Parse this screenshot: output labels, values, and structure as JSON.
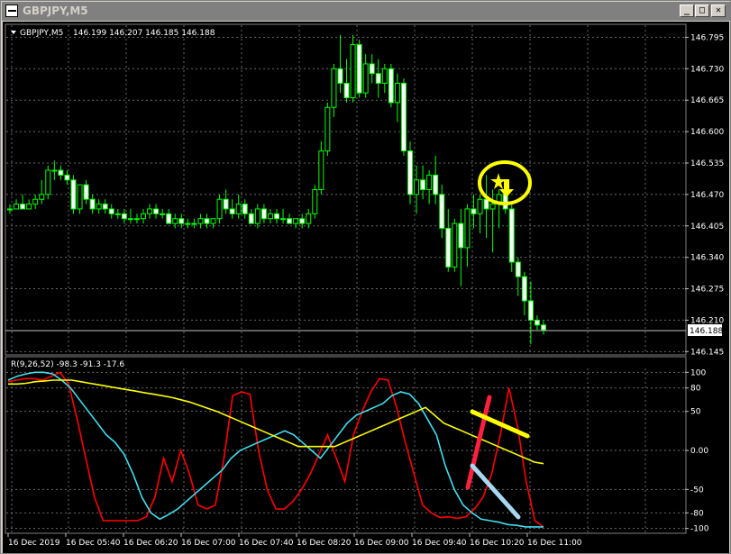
{
  "window": {
    "title": "GBPJPY,M5"
  },
  "colors": {
    "bg": "#000000",
    "grid": "#c0c0c0",
    "bull": "#00ff00",
    "bear": "#ffffff",
    "red": "#ff0000",
    "cyan": "#40e0f0",
    "yellow": "#ffff00",
    "text": "#ffffff"
  },
  "icons": {
    "window": "app-chart-icon",
    "minimize": "minimize-icon",
    "maximize": "maximize-icon",
    "close": "close-icon",
    "collapse": "triangle-down-icon",
    "signal_star": "star-icon",
    "signal_arrow": "down-arrow-icon",
    "highlight": "yellow-circle-annotation"
  },
  "chart_data": [
    {
      "type": "candlestick",
      "title": "GBPJPY,M5",
      "ohlc_header": "146.199 146.207 146.185 146.188",
      "current_price": "146.188",
      "y_ticks": [
        "146.795",
        "146.730",
        "146.665",
        "146.600",
        "146.535",
        "146.470",
        "146.405",
        "146.340",
        "146.275",
        "146.210",
        "146.145"
      ],
      "ylim": [
        146.14,
        146.82
      ],
      "x_labels": [
        "16 Dec 2019",
        "16 Dec 05:40",
        "16 Dec 06:20",
        "16 Dec 07:00",
        "16 Dec 07:40",
        "16 Dec 08:20",
        "16 Dec 09:00",
        "16 Dec 09:40",
        "16 Dec 10:20",
        "16 Dec 11:00"
      ],
      "grid": true,
      "candles": [
        [
          146.44,
          146.45,
          146.43,
          146.44
        ],
        [
          146.44,
          146.46,
          146.44,
          146.45
        ],
        [
          146.45,
          146.47,
          146.44,
          146.44
        ],
        [
          146.44,
          146.46,
          146.44,
          146.45
        ],
        [
          146.45,
          146.47,
          146.44,
          146.46
        ],
        [
          146.46,
          146.5,
          146.45,
          146.47
        ],
        [
          146.47,
          146.53,
          146.46,
          146.52
        ],
        [
          146.52,
          146.54,
          146.5,
          146.52
        ],
        [
          146.52,
          146.53,
          146.5,
          146.51
        ],
        [
          146.51,
          146.52,
          146.49,
          146.5
        ],
        [
          146.5,
          146.51,
          146.43,
          146.44
        ],
        [
          146.44,
          146.49,
          146.43,
          146.49
        ],
        [
          146.49,
          146.5,
          146.45,
          146.46
        ],
        [
          146.46,
          146.47,
          146.43,
          146.44
        ],
        [
          146.44,
          146.46,
          146.43,
          146.45
        ],
        [
          146.45,
          146.46,
          146.43,
          146.44
        ],
        [
          146.44,
          146.45,
          146.42,
          146.43
        ],
        [
          146.43,
          146.44,
          146.42,
          146.43
        ],
        [
          146.43,
          146.44,
          146.41,
          146.42
        ],
        [
          146.42,
          146.44,
          146.41,
          146.42
        ],
        [
          146.42,
          146.43,
          146.41,
          146.42
        ],
        [
          146.42,
          146.44,
          146.41,
          146.43
        ],
        [
          146.43,
          146.45,
          146.42,
          146.44
        ],
        [
          146.44,
          146.45,
          146.42,
          146.43
        ],
        [
          146.43,
          146.44,
          146.42,
          146.43
        ],
        [
          146.43,
          146.44,
          146.41,
          146.41
        ],
        [
          146.41,
          146.43,
          146.4,
          146.42
        ],
        [
          146.42,
          146.43,
          146.4,
          146.41
        ],
        [
          146.41,
          146.42,
          146.4,
          146.41
        ],
        [
          146.41,
          146.42,
          146.4,
          146.41
        ],
        [
          146.41,
          146.43,
          146.4,
          146.42
        ],
        [
          146.42,
          146.43,
          146.4,
          146.41
        ],
        [
          146.41,
          146.42,
          146.4,
          146.42
        ],
        [
          146.42,
          146.47,
          146.41,
          146.46
        ],
        [
          146.46,
          146.48,
          146.43,
          146.44
        ],
        [
          146.44,
          146.46,
          146.42,
          146.43
        ],
        [
          146.43,
          146.47,
          146.42,
          146.45
        ],
        [
          146.45,
          146.46,
          146.42,
          146.43
        ],
        [
          146.43,
          146.44,
          146.41,
          146.41
        ],
        [
          146.41,
          146.45,
          146.4,
          146.44
        ],
        [
          146.44,
          146.45,
          146.41,
          146.42
        ],
        [
          146.42,
          146.44,
          146.41,
          146.43
        ],
        [
          146.43,
          146.44,
          146.41,
          146.42
        ],
        [
          146.42,
          146.44,
          146.41,
          146.42
        ],
        [
          146.42,
          146.43,
          146.41,
          146.41
        ],
        [
          146.41,
          146.42,
          146.4,
          146.42
        ],
        [
          146.42,
          146.43,
          146.4,
          146.41
        ],
        [
          146.41,
          146.44,
          146.4,
          146.43
        ],
        [
          146.43,
          146.49,
          146.42,
          146.48
        ],
        [
          146.48,
          146.58,
          146.47,
          146.56
        ],
        [
          146.56,
          146.66,
          146.55,
          146.65
        ],
        [
          146.65,
          146.74,
          146.63,
          146.73
        ],
        [
          146.73,
          146.8,
          146.68,
          146.7
        ],
        [
          146.7,
          146.75,
          146.66,
          146.67
        ],
        [
          146.67,
          146.8,
          146.66,
          146.78
        ],
        [
          146.78,
          146.79,
          146.67,
          146.68
        ],
        [
          146.68,
          146.76,
          146.67,
          146.74
        ],
        [
          146.74,
          146.76,
          146.7,
          146.72
        ],
        [
          146.72,
          146.75,
          146.67,
          146.7
        ],
        [
          146.7,
          146.74,
          146.68,
          146.73
        ],
        [
          146.73,
          146.74,
          146.65,
          146.66
        ],
        [
          146.66,
          146.72,
          146.62,
          146.7
        ],
        [
          146.7,
          146.71,
          146.55,
          146.56
        ],
        [
          146.56,
          146.58,
          146.45,
          146.47
        ],
        [
          146.47,
          146.53,
          146.43,
          146.5
        ],
        [
          146.5,
          146.53,
          146.46,
          146.48
        ],
        [
          146.48,
          146.52,
          146.45,
          146.51
        ],
        [
          146.51,
          146.55,
          146.45,
          146.47
        ],
        [
          146.47,
          146.49,
          146.38,
          146.4
        ],
        [
          146.4,
          146.44,
          146.31,
          146.32
        ],
        [
          146.32,
          146.42,
          146.31,
          146.41
        ],
        [
          146.41,
          146.44,
          146.28,
          146.36
        ],
        [
          146.36,
          146.45,
          146.32,
          146.44
        ],
        [
          146.44,
          146.47,
          146.4,
          146.43
        ],
        [
          146.43,
          146.47,
          146.39,
          146.46
        ],
        [
          146.46,
          146.51,
          146.38,
          146.44
        ],
        [
          146.44,
          146.48,
          146.35,
          146.45
        ],
        [
          146.45,
          146.48,
          146.4,
          146.47
        ],
        [
          146.47,
          146.49,
          146.43,
          146.44
        ],
        [
          146.44,
          146.45,
          146.31,
          146.33
        ],
        [
          146.33,
          146.34,
          146.26,
          146.3
        ],
        [
          146.3,
          146.31,
          146.22,
          146.25
        ],
        [
          146.25,
          146.29,
          146.16,
          146.21
        ],
        [
          146.21,
          146.22,
          146.19,
          146.2
        ],
        [
          146.2,
          146.21,
          146.18,
          146.19
        ]
      ],
      "signal": {
        "type": "sell-arrow",
        "at_index": 78,
        "price": 146.47
      }
    },
    {
      "type": "line",
      "title": "R(9,26,52) -98.3 -91.3 -17.6",
      "y_ticks": [
        "100",
        "80",
        "50",
        "0.00",
        "-50",
        "-80",
        "-100"
      ],
      "ylim": [
        -105,
        105
      ],
      "series": [
        {
          "color": "#ff0000",
          "values": [
            88,
            90,
            92,
            92,
            90,
            95,
            100,
            85,
            40,
            -10,
            -60,
            -90,
            -90,
            -90,
            -90,
            -90,
            -85,
            -60,
            -10,
            -40,
            0,
            -30,
            -70,
            -75,
            -70,
            -10,
            70,
            75,
            72,
            0,
            -50,
            -75,
            -75,
            -65,
            -50,
            -30,
            -5,
            20,
            -10,
            -40,
            20,
            50,
            75,
            92,
            90,
            55,
            10,
            -30,
            -70,
            -80,
            -86,
            -85,
            -87,
            -85,
            -75,
            -60,
            -30,
            20,
            80,
            30,
            -40,
            -90,
            -98
          ]
        },
        {
          "color": "#40e0f0",
          "values": [
            90,
            95,
            98,
            100,
            100,
            98,
            90,
            80,
            65,
            50,
            35,
            20,
            10,
            -5,
            -30,
            -60,
            -80,
            -88,
            -82,
            -75,
            -65,
            -55,
            -45,
            -35,
            -25,
            -10,
            0,
            5,
            10,
            15,
            20,
            25,
            20,
            10,
            0,
            -10,
            5,
            20,
            35,
            45,
            50,
            55,
            60,
            70,
            75,
            72,
            60,
            40,
            20,
            -20,
            -50,
            -70,
            -80,
            -88,
            -90,
            -92,
            -95,
            -96,
            -98,
            -98,
            -98
          ]
        },
        {
          "color": "#ffff00",
          "values": [
            85,
            85,
            86,
            88,
            89,
            90,
            90,
            90,
            88,
            86,
            84,
            82,
            80,
            78,
            76,
            74,
            72,
            70,
            68,
            65,
            62,
            58,
            54,
            50,
            45,
            40,
            35,
            30,
            25,
            20,
            15,
            10,
            5,
            5,
            5,
            5,
            5,
            10,
            15,
            20,
            25,
            30,
            35,
            40,
            45,
            50,
            55,
            45,
            35,
            30,
            25,
            20,
            15,
            10,
            5,
            0,
            -5,
            -10,
            -15,
            -17
          ]
        }
      ],
      "annotations": [
        "red-upward-line",
        "yellow-downward-line",
        "lightblue-downward-line"
      ]
    }
  ]
}
